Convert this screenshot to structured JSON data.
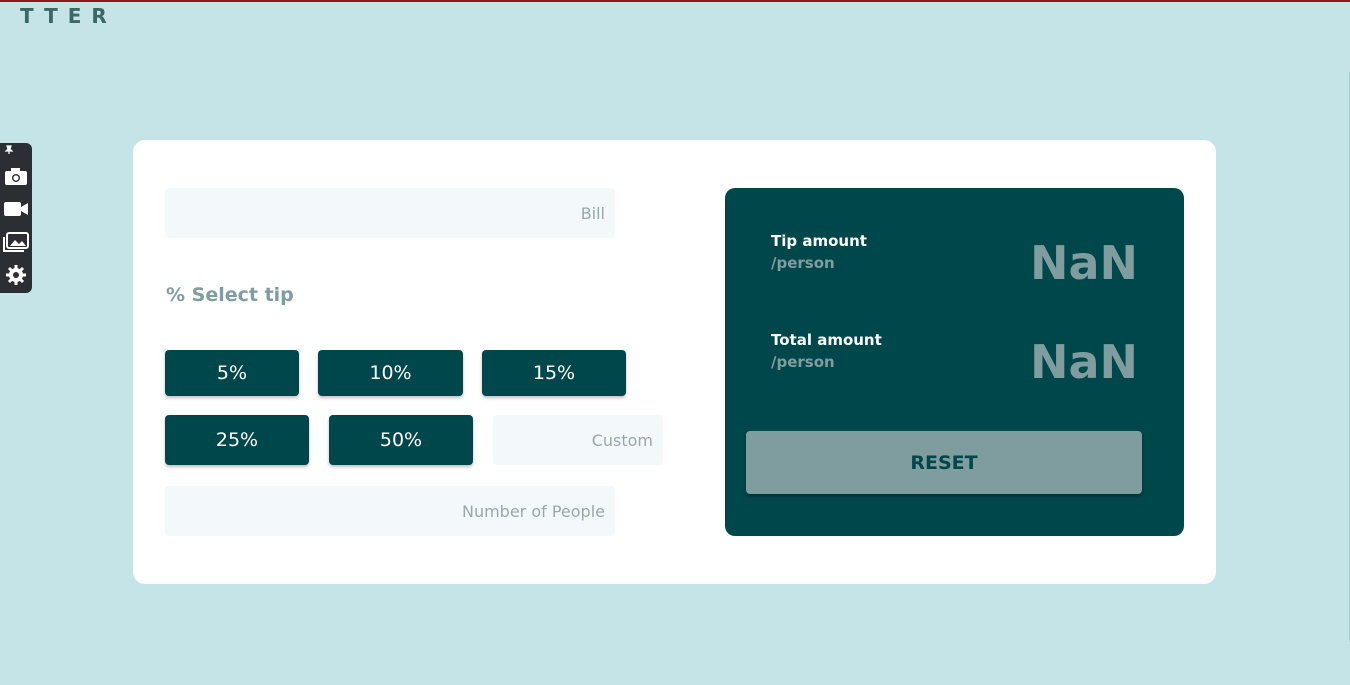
{
  "app": {
    "logo_text": "TTER"
  },
  "toolbar": {
    "icons": [
      "pin-icon",
      "camera-icon",
      "video-icon",
      "gallery-icon",
      "settings-icon"
    ]
  },
  "calculator": {
    "bill_placeholder": "Bill",
    "select_tip_label": "% Select tip",
    "tip_buttons": [
      "5%",
      "10%",
      "15%",
      "25%",
      "50%"
    ],
    "custom_placeholder": "Custom",
    "people_placeholder": "Number of People"
  },
  "results": {
    "tip_label": "Tip amount",
    "tip_per": "/person",
    "tip_value": "NaN",
    "total_label": "Total amount",
    "total_per": "/person",
    "total_value": "NaN",
    "reset_label": "RESET"
  },
  "colors": {
    "background": "#c5e4e7",
    "primary": "#00474b",
    "muted": "#7f9d9f",
    "input_bg": "#f3f9fa"
  }
}
